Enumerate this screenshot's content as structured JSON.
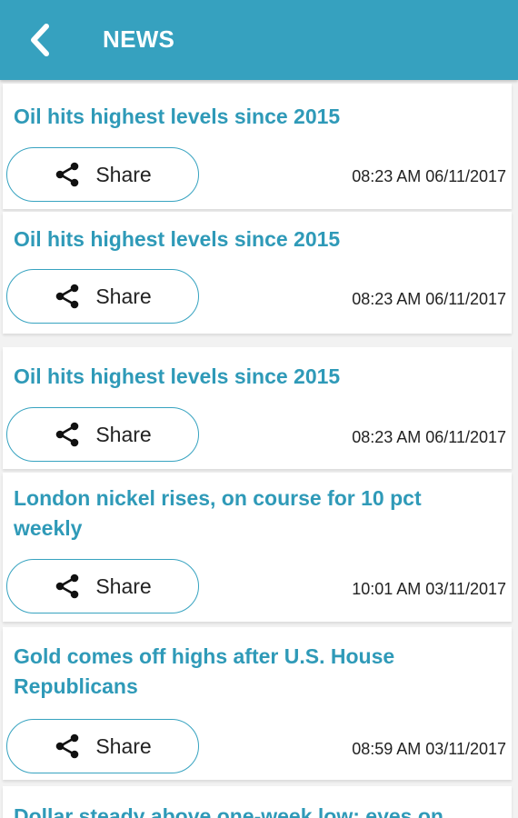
{
  "header": {
    "title": "NEWS",
    "back_icon": "chevron-left-icon"
  },
  "share_label": "Share",
  "share_icon": "share-icon",
  "news": [
    {
      "title": "Oil hits highest levels since 2015",
      "timestamp": "08:23 AM 06/11/2017"
    },
    {
      "title": "Oil hits highest levels since 2015",
      "timestamp": "08:23 AM 06/11/2017"
    },
    {
      "title": "Oil hits highest levels since 2015",
      "timestamp": "08:23 AM 06/11/2017"
    },
    {
      "title": "London nickel rises, on course for 10 pct weekly",
      "timestamp": "10:01 AM 03/11/2017"
    },
    {
      "title": "Gold comes off highs after U.S. House Republicans",
      "timestamp": "08:59 AM 03/11/2017"
    },
    {
      "title": "Dollar steady above one-week low; eyes on"
    }
  ],
  "colors": {
    "header_bg": "#36a1bf",
    "title_text": "#2f9ab8",
    "share_border": "#37a3c0",
    "page_bg": "#f2f2f2"
  }
}
